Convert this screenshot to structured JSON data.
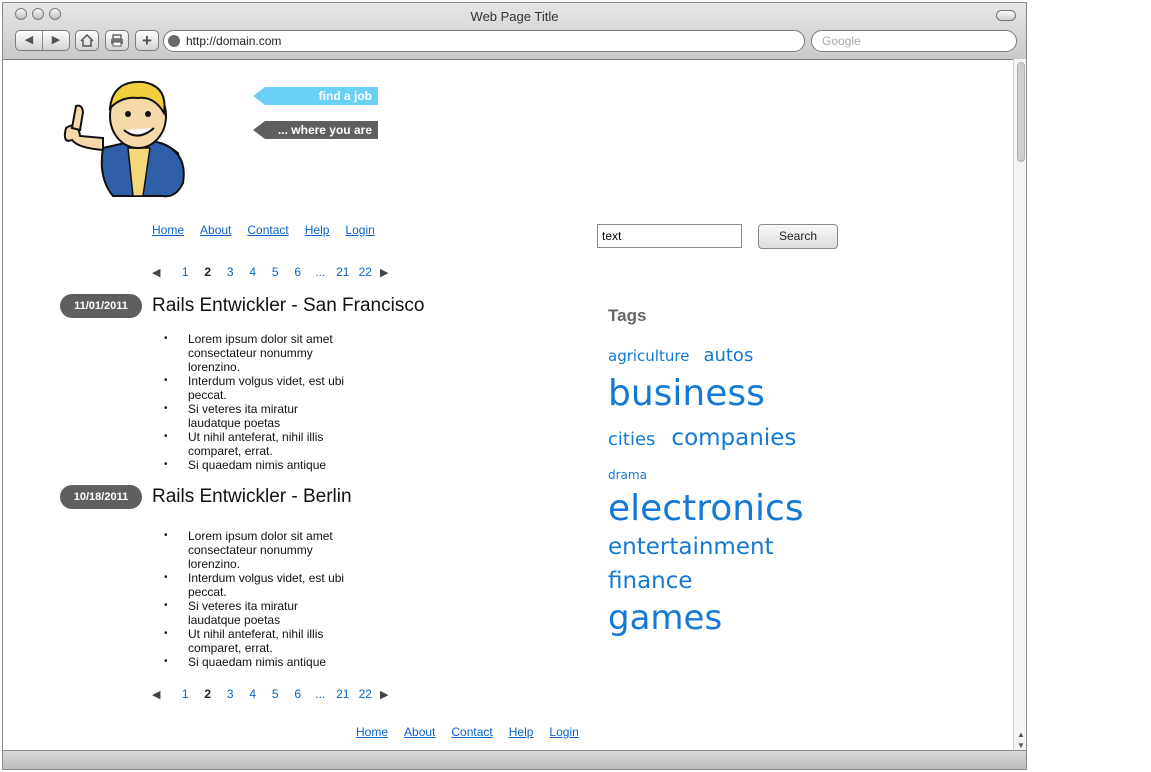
{
  "browser": {
    "window_title": "Web Page Title",
    "url": "http://domain.com",
    "search_placeholder": "Google"
  },
  "hero": {
    "tag1": "find a job",
    "tag2": "... where you are"
  },
  "nav": [
    "Home",
    "About",
    "Contact",
    "Help",
    "Login"
  ],
  "search": {
    "value": "text",
    "button": "Search"
  },
  "pagination": {
    "pages": [
      "1",
      "2",
      "3",
      "4",
      "5",
      "6",
      "...",
      "21",
      "22"
    ],
    "current": "2"
  },
  "jobs": [
    {
      "date": "11/01/2011",
      "title": "Rails Entwickler - San Francisco",
      "bullets": [
        "Lorem ipsum dolor sit amet consectateur nonummy lorenzino.",
        "Interdum volgus videt, est ubi peccat.",
        "Si veteres ita miratur laudatque poetas",
        "Ut nihil anteferat, nihil illis comparet, errat.",
        "Si quaedam nimis antique"
      ]
    },
    {
      "date": "10/18/2011",
      "title": "Rails Entwickler - Berlin",
      "bullets": [
        "Lorem ipsum dolor sit amet consectateur nonummy lorenzino.",
        "Interdum volgus videt, est ubi peccat.",
        "Si veteres ita miratur laudatque poetas",
        "Ut nihil anteferat, nihil illis comparet, errat.",
        "Si quaedam nimis antique"
      ]
    }
  ],
  "tags": {
    "heading": "Tags",
    "items": [
      "agriculture",
      "autos",
      "business",
      "cities",
      "companies",
      "drama",
      "electronics",
      "entertainment",
      "finance",
      "games"
    ]
  },
  "colors": {
    "link": "#0a63c9",
    "tag": "#1479d4",
    "badge": "#5f5f5f",
    "hero_light": "#6ad0f4"
  }
}
